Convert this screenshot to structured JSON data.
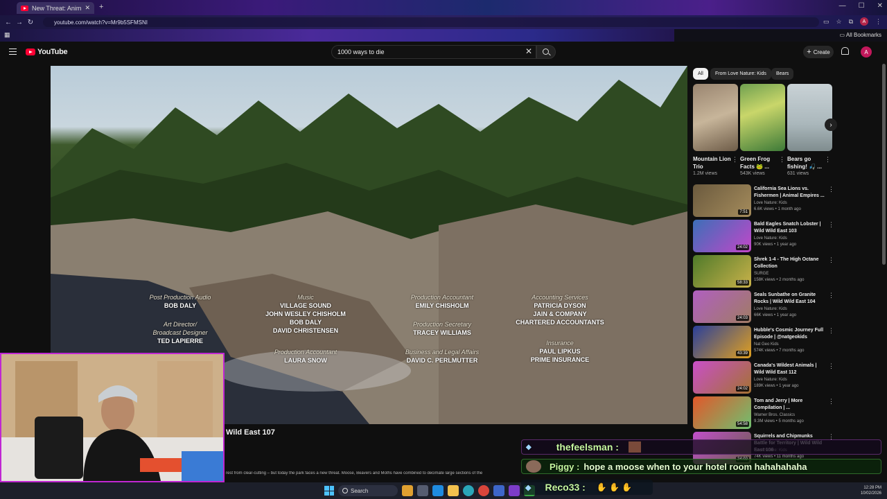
{
  "browser": {
    "tab_title": "New Threat: Animals Team",
    "url": "youtube.com/watch?v=Mr9b5SFMSNI",
    "bookmarks_label": "All Bookmarks",
    "profile_initial": "A"
  },
  "youtube": {
    "logo_text": "YouTube",
    "search_query": "1000 ways to die",
    "create_label": "Create",
    "avatar_initial": "A"
  },
  "video": {
    "credits": [
      {
        "role": "Post Production Audio",
        "names": [
          "BOB DALY"
        ]
      },
      {
        "role": "Music",
        "names": [
          "VILLAGE SOUND",
          "JOHN WESLEY CHISHOLM",
          "BOB DALY",
          "DAVID CHRISTENSEN"
        ]
      },
      {
        "role": "Production Accountant",
        "names": [
          "EMILY CHISHOLM"
        ]
      },
      {
        "role": "Accounting Services",
        "names": [
          "PATRICIA DYSON",
          "JAIN & COMPANY",
          "CHARTERED ACCOUNTANTS"
        ]
      },
      {
        "role": "Art Director/ Broadcast Designer",
        "names": [
          "TED LAPIERRE"
        ]
      },
      {
        "role": "Production Secretary",
        "names": [
          "TRACEY WILLIAMS"
        ]
      },
      {
        "role": "Production Accountant",
        "names": [
          "LAURA SNOW"
        ]
      },
      {
        "role": "Business and Legal Affairs",
        "names": [
          "DAVID C. PERLMUTTER"
        ]
      },
      {
        "role": "Insurance",
        "names": [
          "PAUL LIPKUS",
          "PRIME INSURANCE"
        ]
      }
    ],
    "title_fragment": "Wild East 107",
    "description_fragment": "rest from clear-cutting – but today the park faces a new threat. Moose, Beavers and Moths have combined to decimate large sections of the"
  },
  "sidebar": {
    "chips": [
      "All",
      "From Love Nature: Kids",
      "Bears"
    ],
    "shorts": [
      {
        "title": "Mountain Lion Trio",
        "views": "1.2M views"
      },
      {
        "title": "Green Frog Facts 🐸 ...",
        "views": "543K views"
      },
      {
        "title": "Bears go fishing! 🎣 ...",
        "views": "631 views"
      }
    ],
    "recommendations": [
      {
        "title": "California Sea Lions vs. Fishermen | Animal Empires ...",
        "channel": "Love Nature: Kids",
        "meta": "6.6K views • 1 month ago",
        "duration": "7:51",
        "colors": [
          "#6b5a3e",
          "#a58c5c"
        ]
      },
      {
        "title": "Bald Eagles Snatch Lobster | Wild Wild East 103",
        "channel": "Love Nature: Kids",
        "meta": "90K views • 1 year ago",
        "duration": "24:02",
        "colors": [
          "#3c6fb8",
          "#c247c9"
        ]
      },
      {
        "title": "Shrek 1-4 - The High Octane Collection",
        "channel": "SURGE",
        "meta": "158K views • 2 months ago",
        "duration": "58:33",
        "colors": [
          "#4f7a2a",
          "#c9b24a"
        ]
      },
      {
        "title": "Seals Sunbathe on Granite Rocks | Wild Wild East 104",
        "channel": "Love Nature: Kids",
        "meta": "66K views • 1 year ago",
        "duration": "24:03",
        "colors": [
          "#b05fc0",
          "#a07c64"
        ]
      },
      {
        "title": "Hubble's Cosmic Journey Full Episode | @natgeokids",
        "channel": "Nat Geo Kids",
        "meta": "574K views • 7 months ago",
        "duration": "43:39",
        "colors": [
          "#2a3f9a",
          "#e0a020"
        ]
      },
      {
        "title": "Canada's Wildest Animals | Wild Wild East 112",
        "channel": "Love Nature: Kids",
        "meta": "189K views • 1 year ago",
        "duration": "24:02",
        "colors": [
          "#c94fc8",
          "#a47232"
        ]
      },
      {
        "title": "Tom and Jerry | More Compilation | ...",
        "channel": "Warner Bros. Classics",
        "meta": "9.3M views • 5 months ago",
        "duration": "54:58",
        "colors": [
          "#e2572a",
          "#6fc070"
        ]
      },
      {
        "title": "Squirrels and Chipmunks Battle for Territory | Wild Wild East 106",
        "channel": "Love Nature: Kids",
        "meta": "74K views • 11 months ago",
        "duration": "24:02",
        "colors": [
          "#c14fcb",
          "#6b5e4c"
        ]
      }
    ]
  },
  "chat": [
    {
      "user": "thefeelsman :",
      "message": ""
    },
    {
      "user": "Piggy :",
      "message": "hope a moose when to your hotel room hahahahaha"
    },
    {
      "user": "Reco33 :",
      "message": ""
    }
  ],
  "taskbar": {
    "search_label": "Search",
    "time": "12:28 PM",
    "date": "10/02/2026"
  },
  "colors": {
    "overlay_accent": "#c026d3",
    "chat_green": "#c6f7a0",
    "yt_red": "#ff0033"
  }
}
